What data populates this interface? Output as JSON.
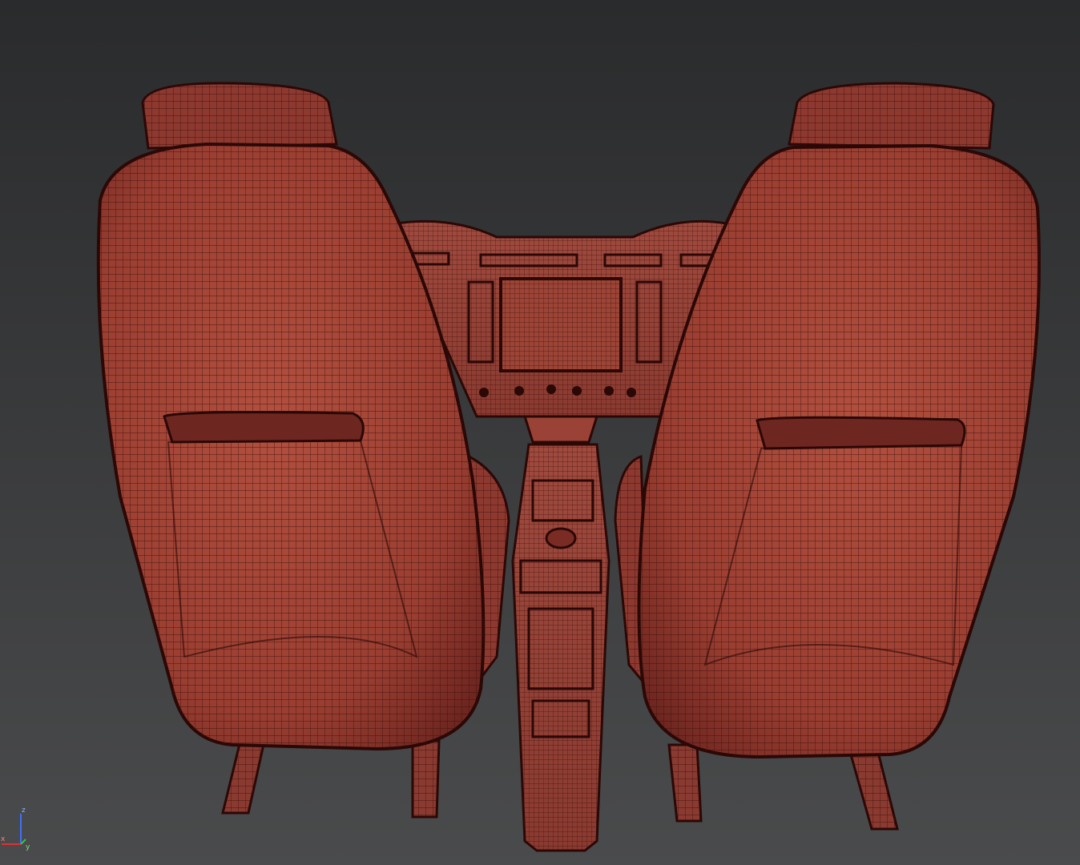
{
  "viewport": {
    "background_top": "#2a2b2c",
    "background_bottom": "#4a4b4c",
    "mesh_fill": "#a8473a",
    "mesh_shade": "#7a2c24",
    "wire_color": "#3a0e0a"
  },
  "gizmo": {
    "z_label": "z",
    "y_label": "y",
    "x_label": "x",
    "z_color": "#3f6fff",
    "y_color": "#2ecc40",
    "x_color": "#e03030"
  },
  "objects": [
    {
      "name": "left-seat",
      "icon": "seat-icon"
    },
    {
      "name": "right-seat",
      "icon": "seat-icon"
    },
    {
      "name": "dashboard",
      "icon": "panel-icon"
    },
    {
      "name": "center-console",
      "icon": "console-icon"
    }
  ]
}
